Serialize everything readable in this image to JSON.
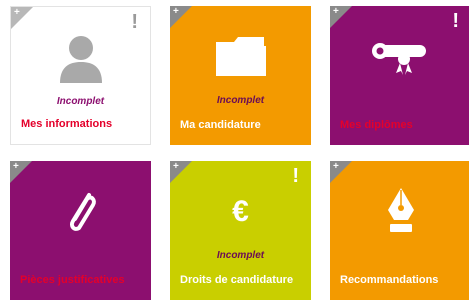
{
  "tiles": [
    {
      "label": "Mes informations",
      "status": "Incomplet",
      "alert": "!",
      "corner": "+",
      "icon": "user-icon"
    },
    {
      "label": "Ma candidature",
      "status": "Incomplet",
      "alert": "",
      "corner": "+",
      "icon": "folder-icon"
    },
    {
      "label": "Mes diplômes",
      "status": "",
      "alert": "!",
      "corner": "+",
      "icon": "diploma-icon"
    },
    {
      "label": "Pièces justificatives",
      "status": "",
      "alert": "",
      "corner": "+",
      "icon": "paperclip-icon"
    },
    {
      "label": "Droits de candidature",
      "status": "Incomplet",
      "alert": "!",
      "corner": "+",
      "icon": "euro-icon"
    },
    {
      "label": "Recommandations",
      "status": "",
      "alert": "",
      "corner": "+",
      "icon": "pen-nib-icon"
    }
  ],
  "icons": {
    "euro": "€"
  },
  "colors": {
    "orange": "#f39a00",
    "purple": "#8c0f6f",
    "lime": "#c9cf00",
    "red_label": "#e4002b",
    "grey_icon": "#a9a9a9"
  }
}
